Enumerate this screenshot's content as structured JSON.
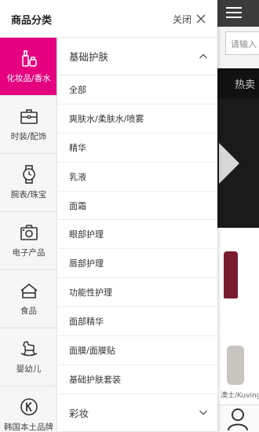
{
  "drawer": {
    "title": "商品分类",
    "close_label": "关闭"
  },
  "categories": [
    {
      "label": "化妆品/香水",
      "icon": "cosmetics-icon",
      "active": true
    },
    {
      "label": "时装/配饰",
      "icon": "briefcase-icon",
      "active": false
    },
    {
      "label": "腕表/珠宝",
      "icon": "watch-icon",
      "active": false
    },
    {
      "label": "电子产品",
      "icon": "camera-icon",
      "active": false
    },
    {
      "label": "食品",
      "icon": "food-icon",
      "active": false
    },
    {
      "label": "婴幼儿",
      "icon": "rocking-horse-icon",
      "active": false
    },
    {
      "label": "韩国本土品牌",
      "icon": "k-brand-icon",
      "active": false
    }
  ],
  "subcategory": {
    "section_title": "基础护肤",
    "items": [
      "全部",
      "爽肤水/柔肤水/喷雾",
      "精华",
      "乳液",
      "面霜",
      "眼部护理",
      "唇部护理",
      "功能性护理",
      "面部精华",
      "面膜/面膜贴",
      "基础护肤套装"
    ],
    "next_section_title": "彩妆"
  },
  "background": {
    "search_placeholder": "请输入",
    "hot_label": "热卖",
    "caption": "澳士/Kuvings"
  },
  "colors": {
    "accent": "#e4007f",
    "topbar": "#3b3b3b"
  }
}
